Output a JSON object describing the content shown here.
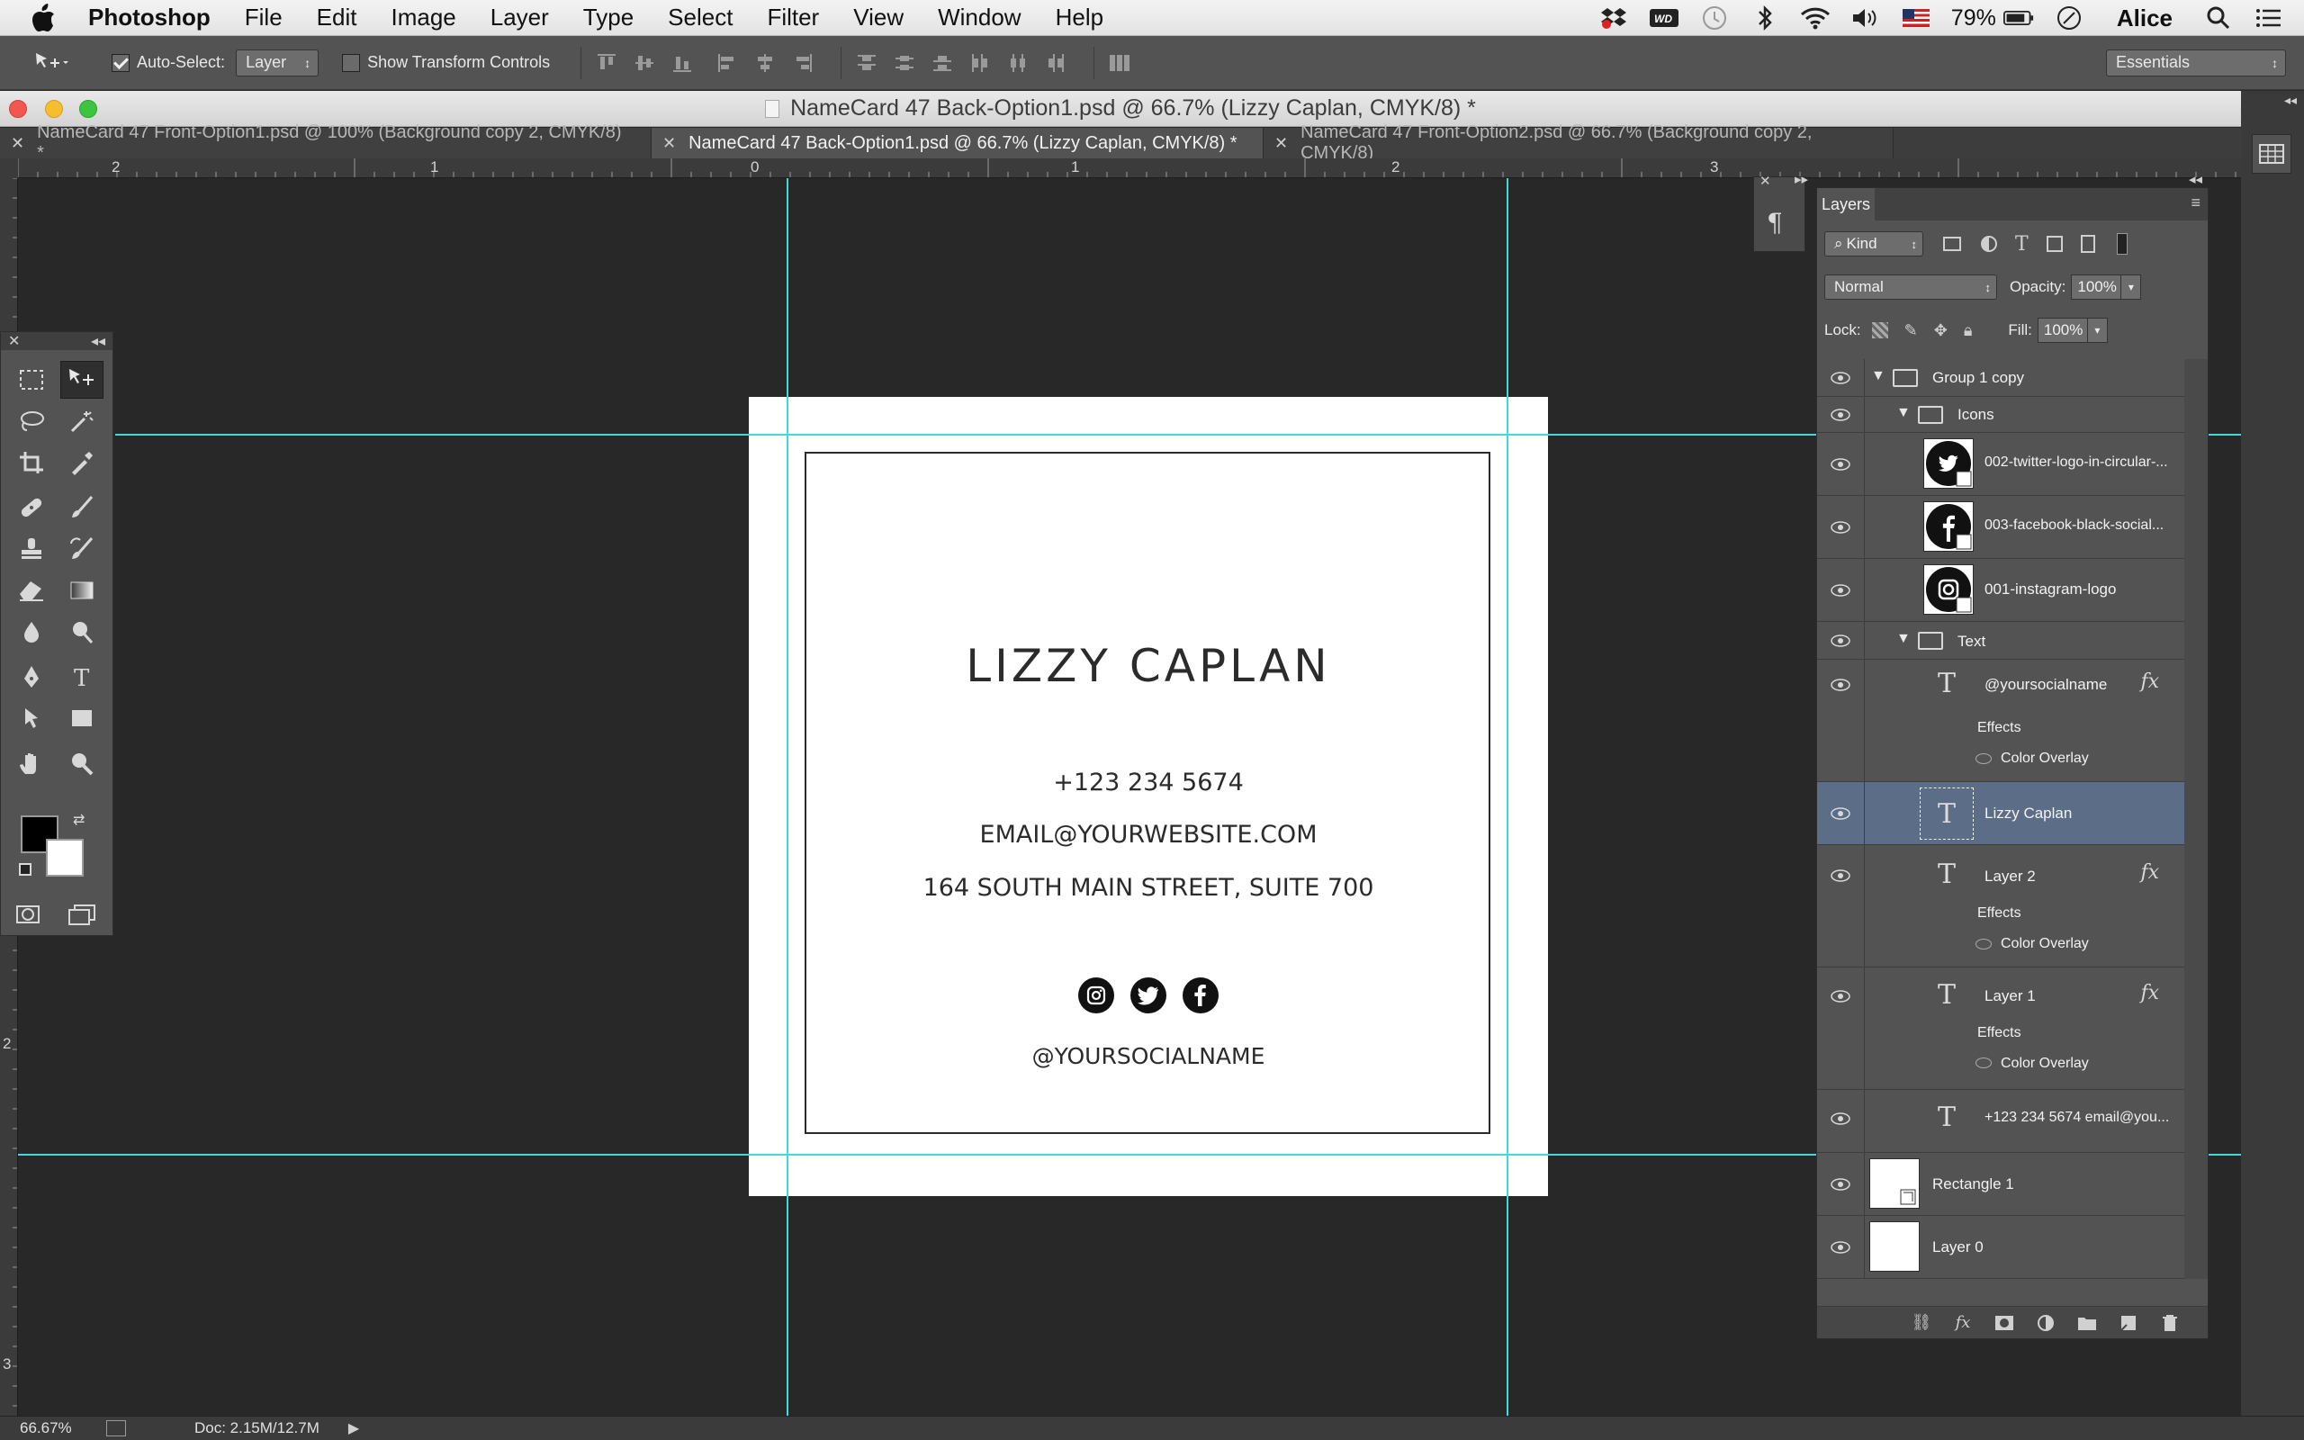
{
  "menubar": {
    "app_name": "Photoshop",
    "items": [
      "File",
      "Edit",
      "Image",
      "Layer",
      "Type",
      "Select",
      "Filter",
      "View",
      "Window",
      "Help"
    ],
    "battery": "79%",
    "user": "Alice",
    "status_icons": [
      "dropbox-icon",
      "wd-icon",
      "time-machine-icon",
      "bluetooth-icon",
      "wifi-icon",
      "volume-icon",
      "flag-icon",
      "battery-icon",
      "clock-icon",
      "search-icon",
      "list-icon"
    ]
  },
  "options_bar": {
    "auto_select_label": "Auto-Select:",
    "auto_select_checked": true,
    "auto_select_value": "Layer",
    "transform_label": "Show Transform Controls",
    "transform_checked": false,
    "workspace": "Essentials"
  },
  "window": {
    "title": "NameCard 47 Back-Option1.psd @ 66.7% (Lizzy Caplan, CMYK/8) *"
  },
  "tabs": [
    {
      "label": "NameCard 47 Front-Option1.psd @ 100% (Background copy 2, CMYK/8) *",
      "active": false
    },
    {
      "label": "NameCard 47 Back-Option1.psd @ 66.7% (Lizzy Caplan, CMYK/8) *",
      "active": true
    },
    {
      "label": "NameCard 47 Front-Option2.psd @ 66.7% (Background copy 2, CMYK/8)",
      "active": false
    }
  ],
  "rulers": {
    "top": [
      "2",
      "1",
      "0",
      "1",
      "2",
      "3"
    ],
    "left": [
      "2",
      "3"
    ]
  },
  "card": {
    "name": "LIZZY CAPLAN",
    "phone": "+123 234 5674",
    "email": "EMAIL@YOURWEBSITE.COM",
    "address": "164 SOUTH MAIN STREET, SUITE 700",
    "social_handle": "@YOURSOCIALNAME",
    "social_icons": [
      "instagram-icon",
      "twitter-icon",
      "facebook-icon"
    ]
  },
  "layers_panel": {
    "tab": "Layers",
    "filter_kind": "Kind",
    "blend_mode": "Normal",
    "opacity_label": "Opacity:",
    "opacity": "100%",
    "lock_label": "Lock:",
    "fill_label": "Fill:",
    "fill": "100%",
    "layers": [
      {
        "name": "Group 1 copy",
        "kind": "group"
      },
      {
        "name": "Icons",
        "kind": "group"
      },
      {
        "name": "002-twitter-logo-in-circular-...",
        "kind": "smart"
      },
      {
        "name": "003-facebook-black-social...",
        "kind": "smart"
      },
      {
        "name": "001-instagram-logo",
        "kind": "smart"
      },
      {
        "name": "Text",
        "kind": "group"
      },
      {
        "name": "@yoursocialname",
        "kind": "text",
        "fx": "fx",
        "effects": "Effects",
        "effect": "Color Overlay"
      },
      {
        "name": "Lizzy Caplan",
        "kind": "text",
        "selected": true
      },
      {
        "name": "Layer 2",
        "kind": "text",
        "fx": "fx",
        "effects": "Effects",
        "effect": "Color Overlay"
      },
      {
        "name": "Layer 1",
        "kind": "text",
        "fx": "fx",
        "effects": "Effects",
        "effect": "Color Overlay"
      },
      {
        "name": "+123 234 5674 email@you...",
        "kind": "text"
      },
      {
        "name": "Rectangle 1",
        "kind": "shape"
      },
      {
        "name": "Layer 0",
        "kind": "pixel"
      }
    ]
  },
  "status_bar": {
    "zoom": "66.67%",
    "doc_size": "Doc: 2.15M/12.7M"
  },
  "colors": {
    "guide": "#41d9d9",
    "selected_layer": "#5b6d87",
    "panel": "#535353",
    "canvas": "#282828"
  }
}
